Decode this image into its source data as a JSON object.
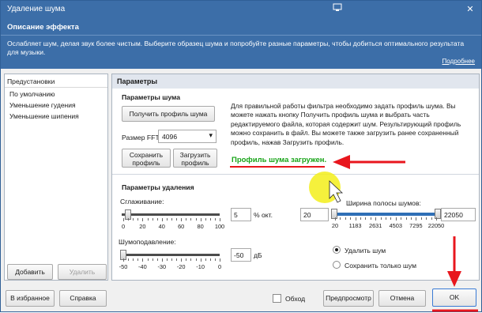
{
  "window": {
    "title": "Удаление шума"
  },
  "description": {
    "heading": "Описание эффекта",
    "text": "Ослабляет шум, делая звук более чистым. Выберите образец шума и попробуйте разные параметры, чтобы добиться оптимального результата для музыки.",
    "more_link": "Подробнее"
  },
  "presets": {
    "header": "Предустановки",
    "items": [
      "По умолчанию",
      "Уменьшение гудения",
      "Уменьшение шипения"
    ],
    "add_label": "Добавить",
    "remove_label": "Удалить"
  },
  "params": {
    "header": "Параметры",
    "noise_section": "Параметры шума",
    "get_profile_label": "Получить профиль шума",
    "fft_label": "Размер FFT",
    "fft_value": "4096",
    "save_profile_label_1": "Сохранить",
    "save_profile_label_2": "профиль",
    "load_profile_label_1": "Загрузить",
    "load_profile_label_2": "профиль",
    "info_text": "Для правильной работы фильтра необходимо задать профиль шума. Вы можете нажать кнопку Получить профиль шума и выбрать часть редактируемого файла, которая содержит шум. Результирующий профиль можно сохранить в файл. Вы можете также загрузить ранее сохраненный профиль, нажав Загрузить профиль.",
    "status": "Профиль шума загружен.",
    "removal_section": "Параметры удаления",
    "smoothing_label": "Сглаживание:",
    "smoothing_value": "5",
    "smoothing_unit": "% окт.",
    "smoothing_ticks": [
      "0",
      "20",
      "40",
      "60",
      "80",
      "100"
    ],
    "smoothing_level": 5,
    "suppression_label": "Шумоподавление:",
    "suppression_value": "-50",
    "suppression_unit": "дБ",
    "suppression_ticks": [
      "-50",
      "-40",
      "-30",
      "-20",
      "-10",
      "0"
    ],
    "suppression_level": -50,
    "bandwidth_label": "Ширина полосы шумов:",
    "bandwidth_min": "20",
    "bandwidth_max": "22050",
    "bandwidth_ticks": [
      "20",
      "1183",
      "2631",
      "4503",
      "7295",
      "22050"
    ],
    "remove_noise_label": "Удалить шум",
    "keep_noise_label": "Сохранить только шум"
  },
  "footer": {
    "favorites_label": "В избранное",
    "help_label": "Справка",
    "bypass_label": "Обход",
    "preview_label": "Предпросмотр",
    "cancel_label": "Отмена",
    "ok_label": "OK"
  },
  "colors": {
    "title_bar": "#3c6ea8",
    "status_green": "#18a418",
    "annotation_red": "#e8161d",
    "cursor_highlight": "#f3ee1a"
  }
}
